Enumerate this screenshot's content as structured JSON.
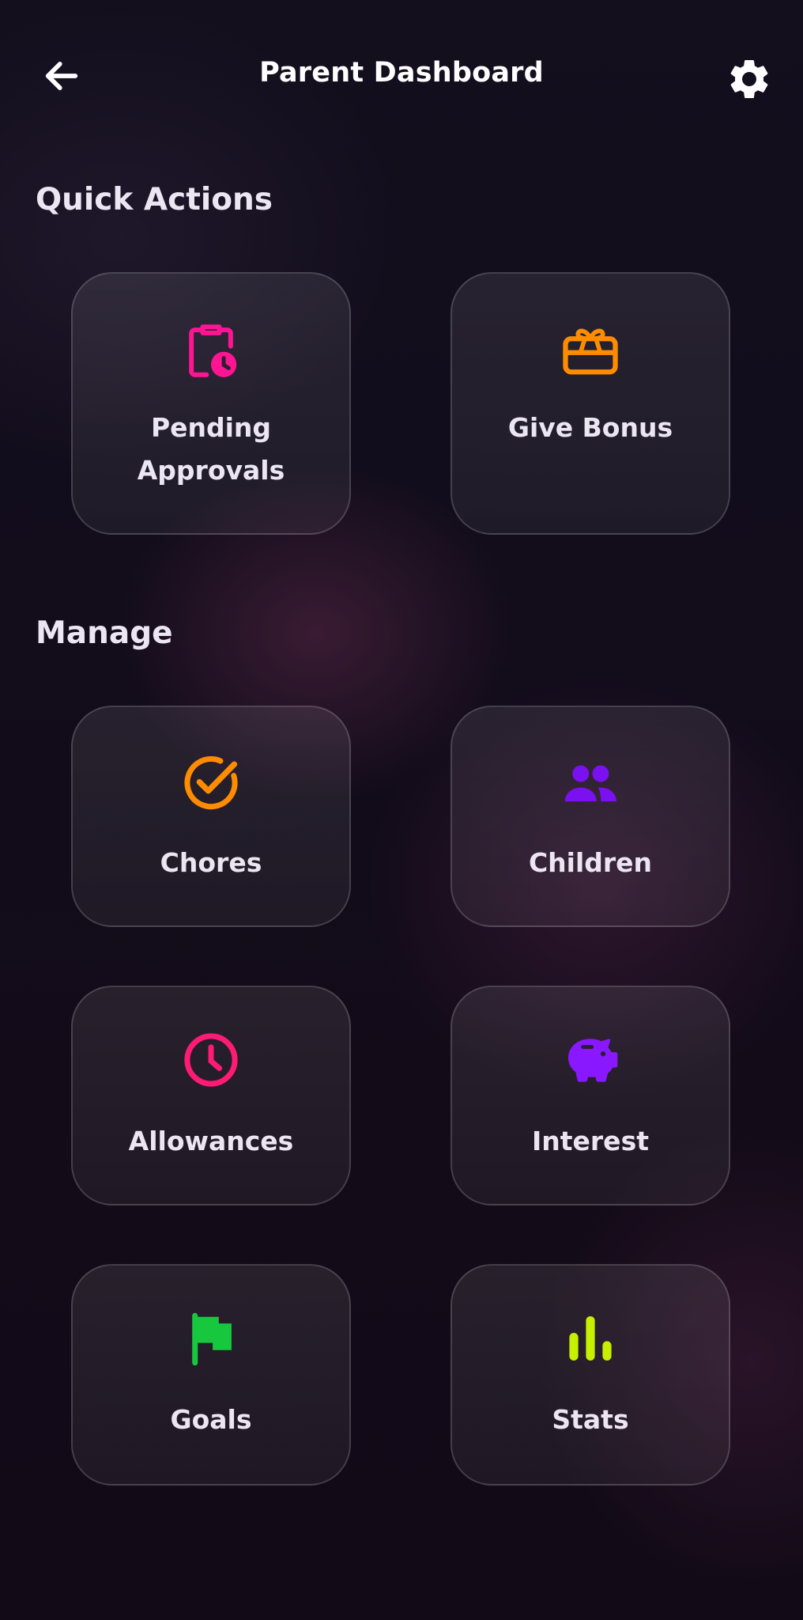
{
  "header": {
    "title": "Parent Dashboard",
    "back_icon": "arrow-left-icon",
    "settings_icon": "gear-icon"
  },
  "quick_actions": {
    "title": "Quick Actions",
    "items": [
      {
        "label_line1": "Pending",
        "label_line2": "Approvals",
        "icon": "clipboard-clock-icon",
        "color": "#ff1493"
      },
      {
        "label": "Give Bonus",
        "icon": "gift-card-icon",
        "color": "#ff8c00"
      }
    ]
  },
  "manage": {
    "title": "Manage",
    "items": [
      {
        "label": "Chores",
        "icon": "check-circle-icon",
        "color": "#ff8c00"
      },
      {
        "label": "Children",
        "icon": "people-icon",
        "color": "#7b10f0"
      },
      {
        "label": "Allowances",
        "icon": "clock-icon",
        "color": "#ff1a75"
      },
      {
        "label": "Interest",
        "icon": "piggy-bank-icon",
        "color": "#8a18ff"
      },
      {
        "label": "Goals",
        "icon": "flag-icon",
        "color": "#17c83f"
      },
      {
        "label": "Stats",
        "icon": "bar-chart-icon",
        "color": "#c6f000"
      }
    ]
  }
}
